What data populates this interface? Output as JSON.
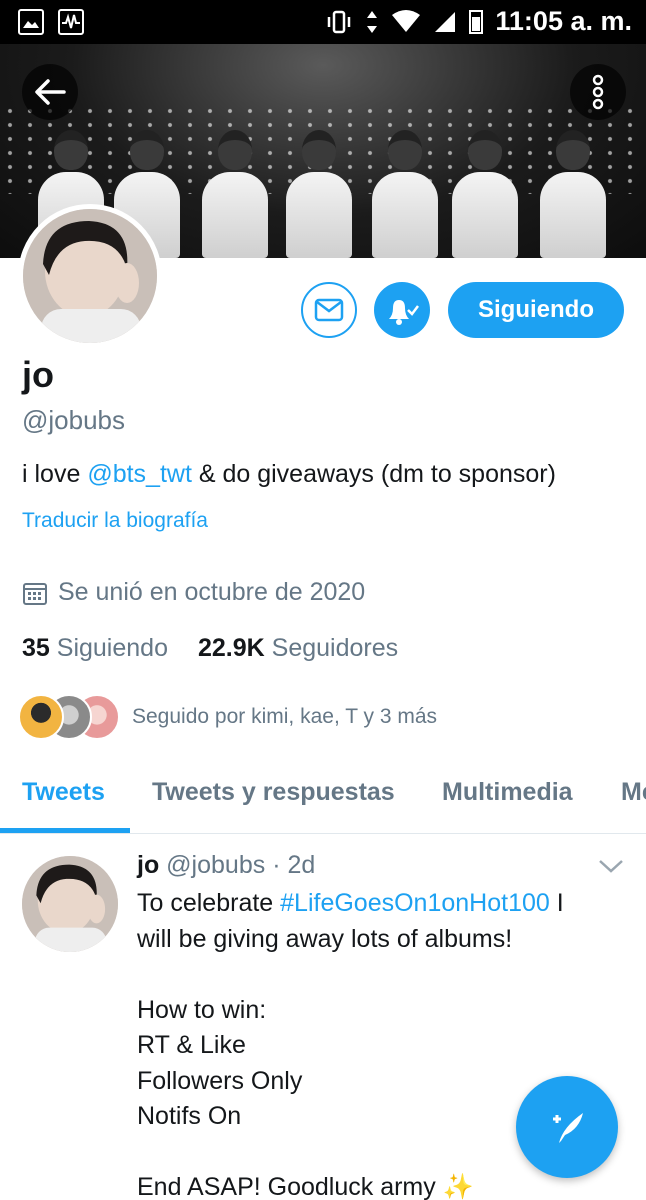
{
  "status_bar": {
    "time": "11:05 a. m."
  },
  "profile": {
    "name": "jo",
    "handle": "@jobubs",
    "bio_prefix": "i love ",
    "bio_mention": "@bts_twt",
    "bio_suffix": " & do giveaways (dm to sponsor)",
    "translate_label": "Traducir la biografía",
    "joined": "Se unió en octubre de 2020",
    "following_count": "35",
    "following_label": "Siguiendo",
    "followers_count": "22.9K",
    "followers_label": "Seguidores",
    "followed_by": "Seguido por kimi, kae, T y 3 más"
  },
  "actions": {
    "follow_button": "Siguiendo"
  },
  "tabs": [
    {
      "label": "Tweets",
      "active": true
    },
    {
      "label": "Tweets y respuestas",
      "active": false
    },
    {
      "label": "Multimedia",
      "active": false
    },
    {
      "label": "Me",
      "active": false
    }
  ],
  "tweet": {
    "name": "jo",
    "handle": "@jobubs",
    "age": "· 2d",
    "line1_prefix": "To celebrate ",
    "line1_hashtag": "#LifeGoesOn1onHot100",
    "line1_suffix": " I",
    "lines": [
      "will be giving away lots of albums!",
      "",
      "How to win:",
      "RT & Like",
      "Followers Only",
      "Notifs On",
      "",
      "End ASAP! Goodluck army"
    ],
    "emoji": "✨"
  },
  "colors": {
    "accent": "#1da1f2",
    "muted": "#657786",
    "text": "#14171a"
  }
}
